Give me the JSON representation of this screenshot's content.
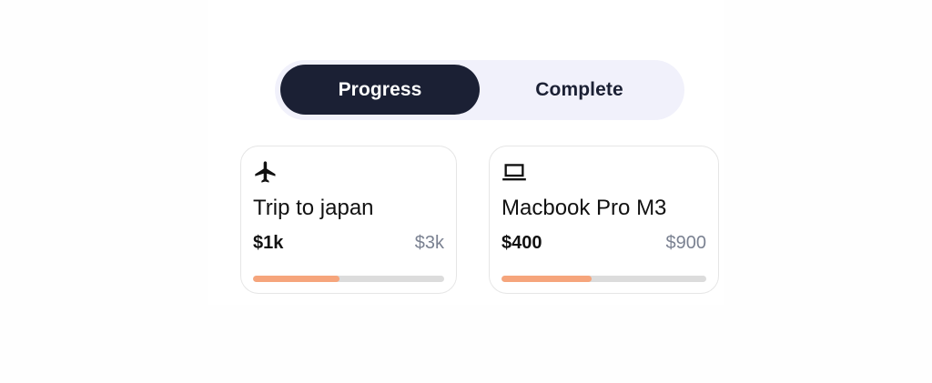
{
  "tabs": {
    "progress_label": "Progress",
    "complete_label": "Complete",
    "selected": "Progress",
    "active_color": "#1b2034",
    "background_color": "#f1f1fb"
  },
  "goals": [
    {
      "icon": "airplane-icon",
      "title": "Trip to japan",
      "saved": "$1k",
      "target": "$3k",
      "progress_fraction": 0.45
    },
    {
      "icon": "laptop-icon",
      "title": "Macbook Pro M3",
      "saved": "$400",
      "target": "$900",
      "progress_fraction": 0.44
    }
  ],
  "colors": {
    "progress_fill": "#f6a57c",
    "progress_track": "#dcdcdc",
    "target_text": "#7a8191"
  }
}
